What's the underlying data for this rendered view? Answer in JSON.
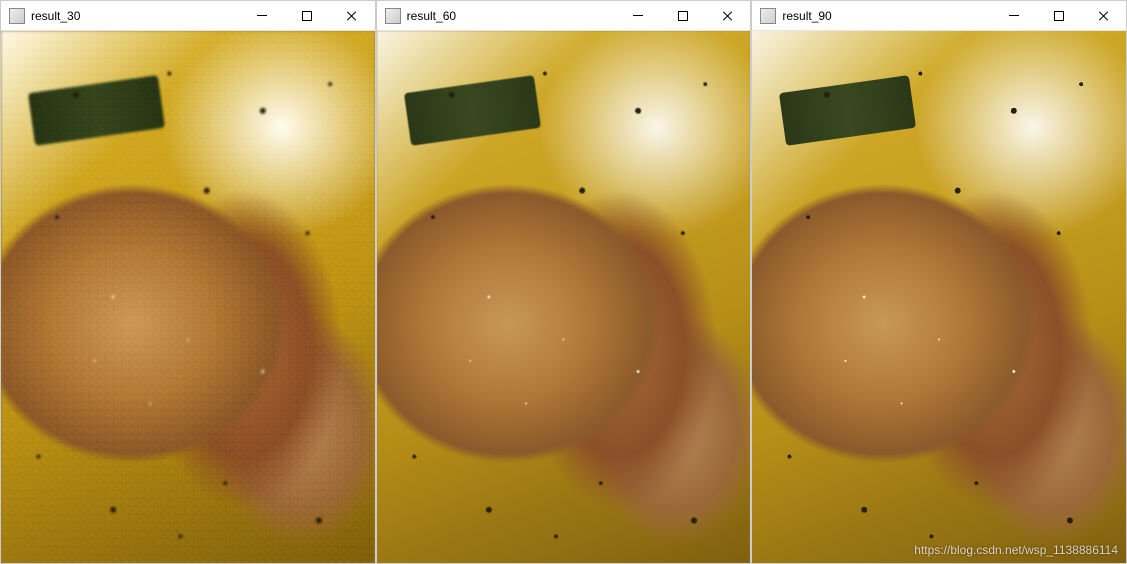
{
  "windows": [
    {
      "title": "result_30",
      "quality_class": "q30"
    },
    {
      "title": "result_60",
      "quality_class": "q60"
    },
    {
      "title": "result_90",
      "quality_class": "q90"
    }
  ],
  "watermark": "https://blog.csdn.net/wsp_1138886114"
}
